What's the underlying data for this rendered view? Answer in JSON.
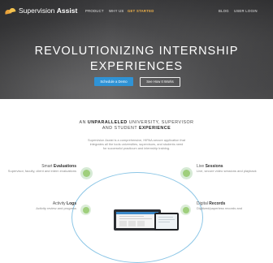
{
  "brand": {
    "name_light": "Supervision",
    "name_bold": "Assist"
  },
  "nav": {
    "items": [
      "PRODUCT",
      "WHY US",
      "GET STARTED"
    ],
    "right": [
      "BLOG",
      "USER LOGIN"
    ]
  },
  "hero": {
    "title_line1": "REVOLUTIONIZING INTERNSHIP",
    "title_line2": "EXPERIENCES",
    "demo_button": "Schedule a Demo",
    "works_button": "See How It Works"
  },
  "intro": {
    "tag_prefix": "AN",
    "tag_b1": "UNPARALLELED",
    "tag_mid": "UNIVERSITY, SUPERVISOR",
    "tag_and": "AND STUDENT",
    "tag_b2": "EXPERIENCE",
    "description": "Supervision Assist is a comprehensive, HIPAA-secure application that integrates all the tools universities, supervisors, and students need for successful practicum and internship training."
  },
  "features": {
    "evaluations": {
      "prefix": "Smart",
      "bold": "Evaluations",
      "desc": "Supervisor, faculty, client and intern evaluations"
    },
    "sessions": {
      "prefix": "Live",
      "bold": "Sessions",
      "desc": "Live, secure video sessions and playback"
    },
    "logs": {
      "prefix": "Activity",
      "bold": "Logs",
      "desc": "Activity review and progress"
    },
    "records": {
      "prefix": "Digital",
      "bold": "Records",
      "desc": "Digitized/paperless records and"
    }
  },
  "colors": {
    "accent_blue": "#2f93d6",
    "accent_orange": "#f0b24a",
    "ring_green": "#9fcf7c"
  }
}
